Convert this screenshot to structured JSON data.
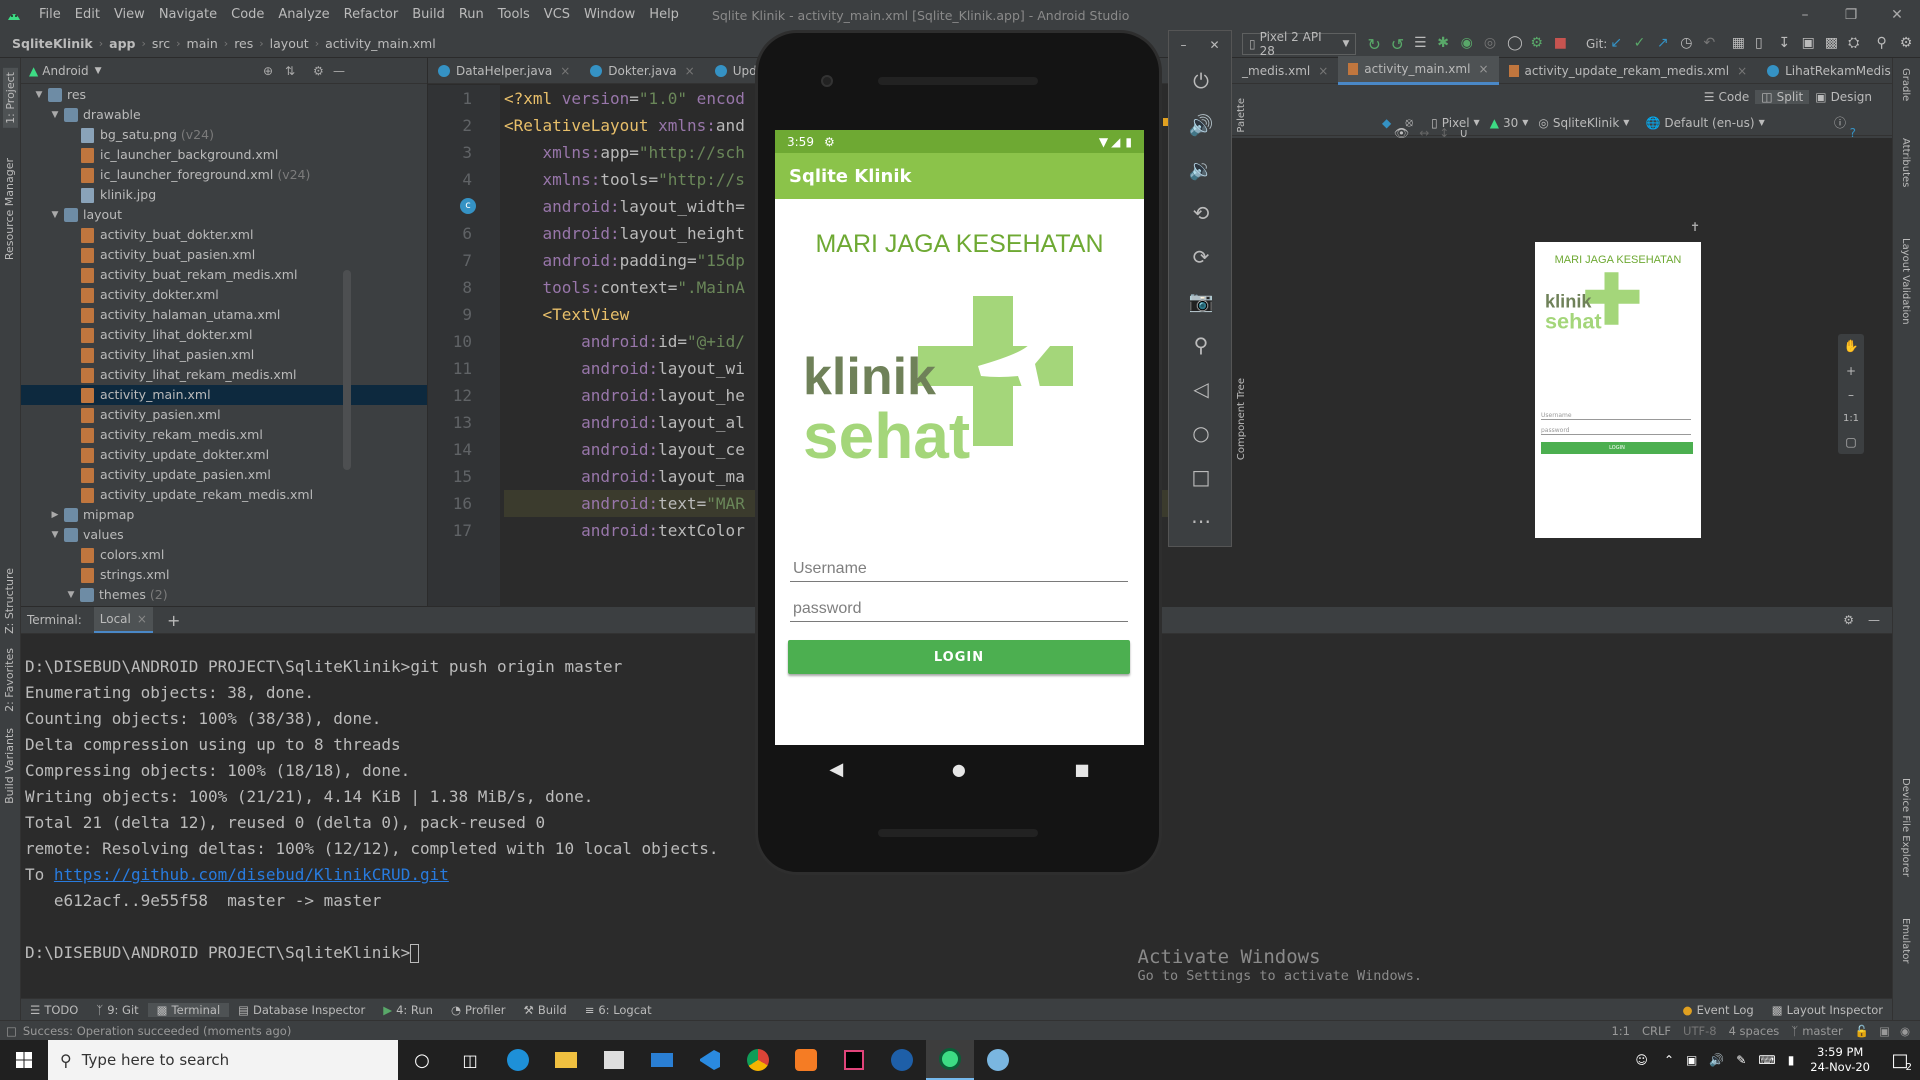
{
  "menubar": {
    "items": [
      "File",
      "Edit",
      "View",
      "Navigate",
      "Code",
      "Analyze",
      "Refactor",
      "Build",
      "Run",
      "Tools",
      "VCS",
      "Window",
      "Help"
    ],
    "title": "Sqlite Klinik - activity_main.xml [Sqlite_Klinik.app] - Android Studio"
  },
  "navbar": {
    "breadcrumbs": [
      "SqliteKlinik",
      "app",
      "src",
      "main",
      "res",
      "layout",
      "activity_main.xml"
    ],
    "device": "Pixel 2 API 28",
    "git_label": "Git:"
  },
  "left_tools": {
    "project": "1: Project",
    "resource_manager": "Resource Manager",
    "structure": "Z: Structure",
    "favorites": "2: Favorites",
    "build_variants": "Build Variants"
  },
  "project_panel": {
    "view_mode": "Android",
    "tree": [
      {
        "label": "res",
        "depth": 0,
        "type": "folder",
        "open": true
      },
      {
        "label": "drawable",
        "depth": 1,
        "type": "folder",
        "open": true
      },
      {
        "label": "bg_satu.png",
        "depth": 2,
        "type": "img",
        "note": "(v24)"
      },
      {
        "label": "ic_launcher_background.xml",
        "depth": 2,
        "type": "xml"
      },
      {
        "label": "ic_launcher_foreground.xml",
        "depth": 2,
        "type": "xml",
        "note": "(v24)"
      },
      {
        "label": "klinik.jpg",
        "depth": 2,
        "type": "img"
      },
      {
        "label": "layout",
        "depth": 1,
        "type": "folder",
        "open": true
      },
      {
        "label": "activity_buat_dokter.xml",
        "depth": 2,
        "type": "xml"
      },
      {
        "label": "activity_buat_pasien.xml",
        "depth": 2,
        "type": "xml"
      },
      {
        "label": "activity_buat_rekam_medis.xml",
        "depth": 2,
        "type": "xml"
      },
      {
        "label": "activity_dokter.xml",
        "depth": 2,
        "type": "xml"
      },
      {
        "label": "activity_halaman_utama.xml",
        "depth": 2,
        "type": "xml"
      },
      {
        "label": "activity_lihat_dokter.xml",
        "depth": 2,
        "type": "xml"
      },
      {
        "label": "activity_lihat_pasien.xml",
        "depth": 2,
        "type": "xml"
      },
      {
        "label": "activity_lihat_rekam_medis.xml",
        "depth": 2,
        "type": "xml"
      },
      {
        "label": "activity_main.xml",
        "depth": 2,
        "type": "xml",
        "selected": true
      },
      {
        "label": "activity_pasien.xml",
        "depth": 2,
        "type": "xml"
      },
      {
        "label": "activity_rekam_medis.xml",
        "depth": 2,
        "type": "xml"
      },
      {
        "label": "activity_update_dokter.xml",
        "depth": 2,
        "type": "xml"
      },
      {
        "label": "activity_update_pasien.xml",
        "depth": 2,
        "type": "xml"
      },
      {
        "label": "activity_update_rekam_medis.xml",
        "depth": 2,
        "type": "xml"
      },
      {
        "label": "mipmap",
        "depth": 1,
        "type": "folder",
        "open": false
      },
      {
        "label": "values",
        "depth": 1,
        "type": "folder",
        "open": true
      },
      {
        "label": "colors.xml",
        "depth": 2,
        "type": "xml"
      },
      {
        "label": "strings.xml",
        "depth": 2,
        "type": "xml"
      },
      {
        "label": "themes",
        "depth": 2,
        "type": "folder",
        "open": true,
        "note": "(2)"
      }
    ]
  },
  "editor": {
    "tabs": [
      "DataHelper.java",
      "Dokter.java",
      "UpdateDok"
    ],
    "line_numbers": [
      "1",
      "2",
      "3",
      "4",
      "5",
      "6",
      "7",
      "8",
      "9",
      "10",
      "11",
      "12",
      "13",
      "14",
      "15",
      "16",
      "17"
    ],
    "lines": [
      [
        {
          "c": "kw",
          "t": "<?xml "
        },
        {
          "c": "at",
          "t": "version"
        },
        {
          "c": "ns",
          "t": "="
        },
        {
          "c": "st",
          "t": "\"1.0\""
        },
        {
          "c": "at",
          "t": " encod"
        }
      ],
      [
        {
          "c": "kw",
          "t": "<RelativeLayout "
        },
        {
          "c": "at",
          "t": "xmlns:"
        },
        {
          "c": "ns",
          "t": "and"
        }
      ],
      [
        {
          "c": "ns",
          "t": "    "
        },
        {
          "c": "at",
          "t": "xmlns:"
        },
        {
          "c": "ns",
          "t": "app="
        },
        {
          "c": "st",
          "t": "\"http://sch"
        }
      ],
      [
        {
          "c": "ns",
          "t": "    "
        },
        {
          "c": "at",
          "t": "xmlns:"
        },
        {
          "c": "ns",
          "t": "tools="
        },
        {
          "c": "st",
          "t": "\"http://s"
        }
      ],
      [
        {
          "c": "ns",
          "t": "    "
        },
        {
          "c": "at",
          "t": "android:"
        },
        {
          "c": "ns",
          "t": "layout_width="
        }
      ],
      [
        {
          "c": "ns",
          "t": "    "
        },
        {
          "c": "at",
          "t": "android:"
        },
        {
          "c": "ns",
          "t": "layout_height"
        }
      ],
      [
        {
          "c": "ns",
          "t": "    "
        },
        {
          "c": "at",
          "t": "android:"
        },
        {
          "c": "ns",
          "t": "padding="
        },
        {
          "c": "st",
          "t": "\"15dp"
        }
      ],
      [
        {
          "c": "ns",
          "t": "    "
        },
        {
          "c": "at",
          "t": "tools:"
        },
        {
          "c": "ns",
          "t": "context="
        },
        {
          "c": "st",
          "t": "\".MainA"
        }
      ],
      [
        {
          "c": "ns",
          "t": "    "
        },
        {
          "c": "kw",
          "t": "<TextView"
        }
      ],
      [
        {
          "c": "ns",
          "t": "        "
        },
        {
          "c": "at",
          "t": "android:"
        },
        {
          "c": "ns",
          "t": "id="
        },
        {
          "c": "st",
          "t": "\"@+id/"
        }
      ],
      [
        {
          "c": "ns",
          "t": "        "
        },
        {
          "c": "at",
          "t": "android:"
        },
        {
          "c": "ns",
          "t": "layout_wi"
        }
      ],
      [
        {
          "c": "ns",
          "t": "        "
        },
        {
          "c": "at",
          "t": "android:"
        },
        {
          "c": "ns",
          "t": "layout_he"
        }
      ],
      [
        {
          "c": "ns",
          "t": "        "
        },
        {
          "c": "at",
          "t": "android:"
        },
        {
          "c": "ns",
          "t": "layout_al"
        }
      ],
      [
        {
          "c": "ns",
          "t": "        "
        },
        {
          "c": "at",
          "t": "android:"
        },
        {
          "c": "ns",
          "t": "layout_ce"
        }
      ],
      [
        {
          "c": "ns",
          "t": "        "
        },
        {
          "c": "at",
          "t": "android:"
        },
        {
          "c": "ns",
          "t": "layout_ma"
        }
      ],
      [
        {
          "c": "ns",
          "t": "        "
        },
        {
          "c": "at",
          "t": "android:"
        },
        {
          "c": "ns",
          "t": "text="
        },
        {
          "c": "st",
          "t": "\"MAR"
        }
      ],
      [
        {
          "c": "ns",
          "t": "        "
        },
        {
          "c": "at",
          "t": "android:"
        },
        {
          "c": "ns",
          "t": "textColor"
        }
      ]
    ]
  },
  "right_panel": {
    "tabs": [
      "_medis.xml",
      "activity_main.xml",
      "activity_update_rekam_medis.xml",
      "LihatRekamMedis.java"
    ],
    "view_modes": [
      "Code",
      "Split",
      "Design"
    ],
    "toolbar": {
      "device": "Pixel",
      "api": "30",
      "theme": "SqliteKlinik",
      "locale": "Default (en-us)"
    },
    "zoom_label": "1:1",
    "side_labels": {
      "palette": "Palette",
      "component_tree": "Component Tree",
      "attributes": "Attributes",
      "layout_validation": "Layout Validation",
      "gradle": "Gradle",
      "device_file_explorer": "Device File Explorer",
      "emulator": "Emulator"
    }
  },
  "phone": {
    "status_time": "3:59",
    "app_title": "Sqlite Klinik",
    "headline": "MARI JAGA KESEHATAN",
    "logo_word1": "klinik",
    "logo_word2": "sehat",
    "username_placeholder": "Username",
    "password_placeholder": "password",
    "login_label": "LOGIN"
  },
  "preview": {
    "headline": "MARI JAGA KESEHATAN",
    "logo_word1": "klinik",
    "logo_word2": "sehat",
    "username_placeholder": "Username",
    "password_placeholder": "password",
    "login_label": "LOGIN"
  },
  "terminal": {
    "header_label": "Terminal:",
    "tab_label": "Local",
    "lines": [
      "D:\\DISEBUD\\ANDROID PROJECT\\SqliteKlinik>git push origin master",
      "Enumerating objects: 38, done.",
      "Counting objects: 100% (38/38), done.",
      "Delta compression using up to 8 threads",
      "Compressing objects: 100% (18/18), done.",
      "Writing objects: 100% (21/21), 4.14 KiB | 1.38 MiB/s, done.",
      "Total 21 (delta 12), reused 0 (delta 0), pack-reused 0",
      "remote: Resolving deltas: 100% (12/12), completed with 10 local objects."
    ],
    "to_prefix": "To ",
    "repo_url": "https://github.com/disebud/KlinikCRUD.git",
    "ref_line": "   e612acf..9e55f58  master -> master",
    "prompt": "D:\\DISEBUD\\ANDROID PROJECT\\SqliteKlinik>",
    "watermark_title": "Activate Windows",
    "watermark_sub": "Go to Settings to activate Windows."
  },
  "bottom_tools": {
    "left": [
      "TODO",
      "9: Git",
      "Terminal",
      "Database Inspector",
      "4: Run",
      "Profiler",
      "Build",
      "6: Logcat"
    ],
    "right": [
      "Event Log",
      "Layout Inspector"
    ]
  },
  "statusline": {
    "message": "Success: Operation succeeded (moments ago)",
    "position": "1:1",
    "line_sep": "CRLF",
    "encoding": "UTF-8",
    "indent": "4 spaces",
    "branch": "master"
  },
  "taskbar": {
    "search_placeholder": "Type here to search",
    "time": "3:59 PM",
    "date": "24-Nov-20",
    "notifications": "2"
  },
  "colors": {
    "accent": "#8bc34a",
    "status": "#6ea933",
    "button": "#4caf50",
    "logo": "#a4d67a",
    "logo_text_dark": "#6f8159"
  }
}
